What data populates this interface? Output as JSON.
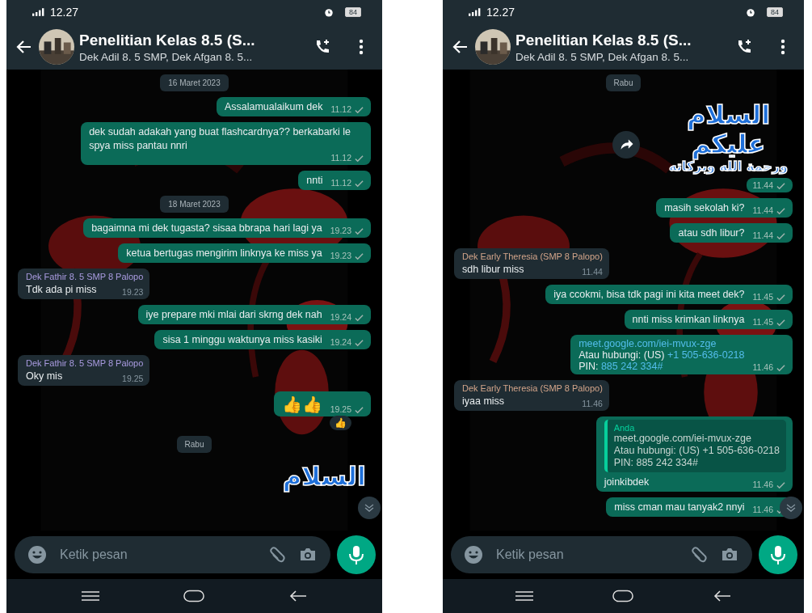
{
  "phones": [
    {
      "status": {
        "time": "12.27",
        "battery": "84"
      },
      "header": {
        "title": "Penelitian Kelas 8.5 (S...",
        "subtitle": "Dek Adil 8. 5 SMP, Dek Afgan 8. 5..."
      },
      "messages": [
        {
          "kind": "date",
          "text": "16 Maret 2023"
        },
        {
          "kind": "out",
          "text": "Assalamualaikum dek",
          "time": "11.12"
        },
        {
          "kind": "out",
          "text": "dek sudah adakah yang buat flashcardnya?? berkabarki le spya miss pantau nnri",
          "time": "11.12"
        },
        {
          "kind": "out",
          "text": "nnti",
          "time": "11.12"
        },
        {
          "kind": "date",
          "text": "18 Maret 2023"
        },
        {
          "kind": "out",
          "text": "bagaimna mi dek tugasta? sisaa bbrapa hari lagi ya",
          "time": "19.23"
        },
        {
          "kind": "out",
          "text": "ketua bertugas mengirim linknya ke miss ya",
          "time": "19.23"
        },
        {
          "kind": "in",
          "sender": "Dek Fathir 8. 5 SMP 8 Palopo",
          "color": "#a99be0",
          "text": "Tdk ada pi miss",
          "time": "19.23"
        },
        {
          "kind": "out",
          "text": "iye prepare mki mlai dari skrng dek nah",
          "time": "19.24"
        },
        {
          "kind": "out",
          "text": "sisa 1 minggu waktunya miss kasiki",
          "time": "19.24"
        },
        {
          "kind": "in",
          "sender": "Dek Fathir 8. 5 SMP 8 Palopo",
          "color": "#a99be0",
          "text": "Oky mis",
          "time": "19.25"
        },
        {
          "kind": "out",
          "text": "👍👍",
          "time": "19.25",
          "reaction": "👍"
        },
        {
          "kind": "date",
          "text": "Rabu"
        },
        {
          "kind": "sticker",
          "lines": [
            "السلام"
          ],
          "forward": false
        }
      ],
      "composer": {
        "placeholder": "Ketik pesan"
      }
    },
    {
      "status": {
        "time": "12.27",
        "battery": "84"
      },
      "header": {
        "title": "Penelitian Kelas 8.5 (S...",
        "subtitle": "Dek Adil 8. 5 SMP, Dek Afgan 8. 5..."
      },
      "messages": [
        {
          "kind": "date",
          "text": "Rabu"
        },
        {
          "kind": "sticker",
          "lines": [
            "السلام",
            "عليكم",
            "ورحمة الله وبركاته"
          ],
          "forward": true,
          "time": "11.44"
        },
        {
          "kind": "out",
          "text": "masih sekolah ki?",
          "time": "11.44"
        },
        {
          "kind": "out",
          "text": "atau sdh libur?",
          "time": "11.44"
        },
        {
          "kind": "in",
          "sender": "Dek Early Theresia (SMP 8 Palopo)",
          "color": "#d4a58a",
          "text": "sdh libur miss",
          "time": "11.44"
        },
        {
          "kind": "out",
          "text": "iya ccokmi, bisa tdk pagi ini kita meet dek?",
          "time": "11.45"
        },
        {
          "kind": "out",
          "text": "nnti miss krimkan linknya",
          "time": "11.45"
        },
        {
          "kind": "link",
          "lines": [
            [
              {
                "t": "meet.google.com/iei-mvux-zge",
                "link": true
              }
            ],
            [
              {
                "t": "Atau hubungi: (US) ",
                "link": false
              },
              {
                "t": "+1 505-636-0218",
                "link": true
              }
            ],
            [
              {
                "t": "PIN: ",
                "link": false
              },
              {
                "t": "885 242 334#",
                "link": true
              }
            ]
          ],
          "time": "11.46"
        },
        {
          "kind": "in",
          "sender": "Dek Early Theresia (SMP 8 Palopo)",
          "color": "#d4a58a",
          "text": "iyaa miss",
          "time": "11.46"
        },
        {
          "kind": "quote",
          "quote_author": "Anda",
          "quote_lines": [
            "meet.google.com/iei-mvux-zge",
            "Atau hubungi: (US) +1 505-636-0218",
            "PIN: 885 242 334#"
          ],
          "text": "joinkibdek",
          "time": "11.46"
        },
        {
          "kind": "out",
          "text": "miss cman  mau tanyak2 nnyi",
          "time": "11.46"
        }
      ],
      "composer": {
        "placeholder": "Ketik pesan"
      }
    }
  ]
}
